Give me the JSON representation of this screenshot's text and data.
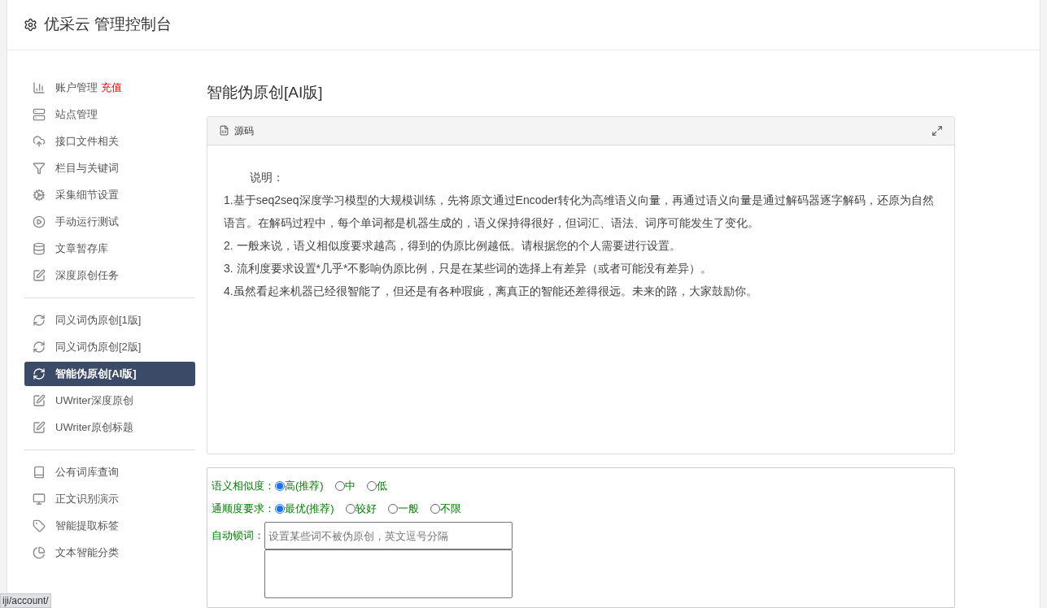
{
  "header": {
    "title": "优采云 管理控制台"
  },
  "sidebar": {
    "groups": [
      {
        "items": [
          {
            "label": "账户管理",
            "badge": "充值",
            "selected": false
          },
          {
            "label": "站点管理",
            "selected": false
          },
          {
            "label": "接口文件相关",
            "selected": false
          },
          {
            "label": "栏目与关键词",
            "selected": false
          },
          {
            "label": "采集细节设置",
            "selected": false
          },
          {
            "label": "手动运行测试",
            "selected": false
          },
          {
            "label": "文章暂存库",
            "selected": false
          },
          {
            "label": "深度原创任务",
            "selected": false
          }
        ]
      },
      {
        "items": [
          {
            "label": "同义词伪原创[1版]",
            "selected": false
          },
          {
            "label": "同义词伪原创[2版]",
            "selected": false
          },
          {
            "label": "智能伪原创[AI版]",
            "selected": true
          },
          {
            "label": "UWriter深度原创",
            "selected": false
          },
          {
            "label": "UWriter原创标题",
            "selected": false
          }
        ]
      },
      {
        "items": [
          {
            "label": "公有词库查询",
            "selected": false
          },
          {
            "label": "正文识别演示",
            "selected": false
          },
          {
            "label": "智能提取标签",
            "selected": false
          },
          {
            "label": "文本智能分类",
            "selected": false
          }
        ]
      }
    ]
  },
  "page_title": "智能伪原创[AI版]",
  "editor": {
    "tab": "源码",
    "lines": [
      "说明：",
      "1.基于seq2seq深度学习模型的大规模训练，先将原文通过Encoder转化为高维语义向量，再通过语义向量是通过解码器逐字解码，还原为自然语言。在解码过程中，每个单词都是机器生成的，语义保持得很好，但词汇、语法、词序可能发生了变化。",
      "2. 一般来说，语义相似度要求越高，得到的伪原比例越低。请根据您的个人需要进行设置。",
      "3. 流利度要求设置*几乎*不影响伪原比例，只是在某些词的选择上有差异（或者可能没有差异）。",
      "4.虽然看起来机器已经很智能了，但还是有各种瑕疵，离真正的智能还差得很远。未来的路，大家鼓励你。"
    ]
  },
  "options": [
    {
      "label": "语义相似度：",
      "choices": [
        {
          "label": "高(推荐)",
          "selected": true
        },
        {
          "label": "中",
          "selected": false
        },
        {
          "label": "低",
          "selected": false
        }
      ]
    },
    {
      "label": "通顺度要求：",
      "choices": [
        {
          "label": "最优(推荐)",
          "selected": true
        },
        {
          "label": "较好",
          "selected": false
        },
        {
          "label": "一般",
          "selected": false
        },
        {
          "label": "不限",
          "selected": false
        }
      ]
    }
  ],
  "lock_words": {
    "label": "自动锁词：",
    "placeholder": "设置某些词不被伪原创，英文逗号分隔"
  },
  "status_bar": {
    "url": "iji/account/"
  }
}
